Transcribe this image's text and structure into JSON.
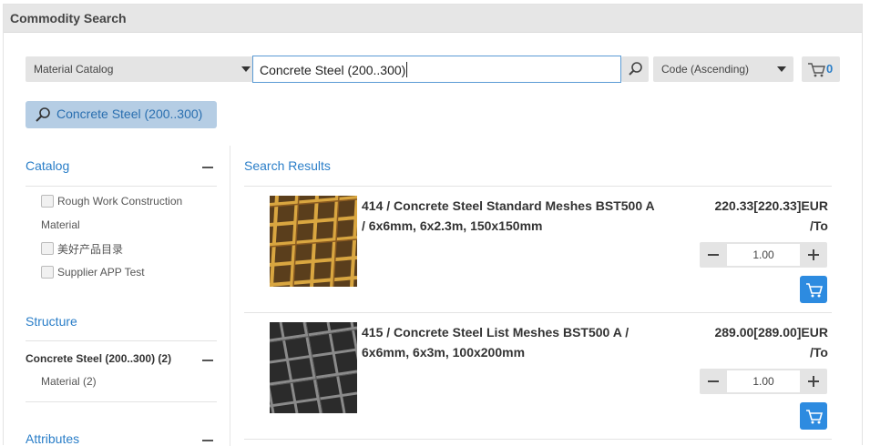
{
  "window": {
    "title": "Commodity Search"
  },
  "toolbar": {
    "catalog_select": "Material Catalog",
    "search_value": "Concrete Steel (200..300)",
    "sort_select": "Code (Ascending)",
    "cart_count": "0"
  },
  "filter_chip": {
    "label": "Concrete Steel (200..300)"
  },
  "sidebar": {
    "catalog": {
      "title": "Catalog",
      "items": [
        {
          "label_line1": "Rough Work Construction",
          "label_line2": "Material"
        },
        {
          "label": "美好产品目录"
        },
        {
          "label": "Supplier APP Test"
        }
      ]
    },
    "structure": {
      "title": "Structure",
      "items": [
        {
          "label": "Concrete Steel (200..300) (2)"
        },
        {
          "label": "Material (2)"
        }
      ]
    },
    "attributes": {
      "title": "Attributes"
    }
  },
  "results": {
    "title": "Search Results",
    "items": [
      {
        "name_line1": "414 / Concrete Steel Standard Meshes BST500 A",
        "name_line2": "/ 6x6mm, 6x2.3m, 150x150mm",
        "price_line1": "220.33[220.33]EUR",
        "price_line2": "/To",
        "quantity": "1.00",
        "image": "rusty-steel-mesh-image"
      },
      {
        "name_line1": "415 / Concrete Steel List Meshes BST500 A /",
        "name_line2": "6x6mm, 6x3m, 100x200mm",
        "price_line1": "289.00[289.00]EUR",
        "price_line2": "/To",
        "quantity": "1.00",
        "image": "dark-steel-mesh-image"
      }
    ]
  },
  "colors": {
    "accent": "#2a7ec8",
    "chip_bg": "#b5cde4",
    "cart_button": "#2d8be0",
    "control_bg": "#e4e4e4"
  }
}
